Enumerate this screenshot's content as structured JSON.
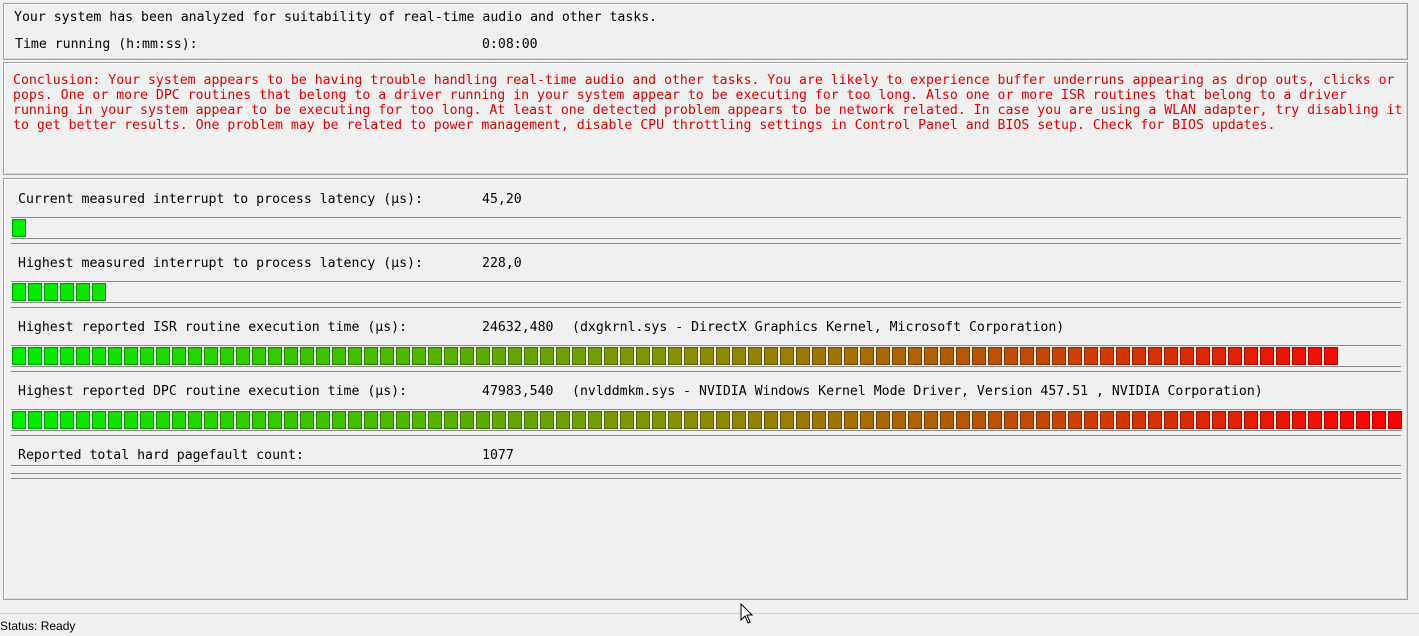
{
  "header": {
    "intro": "Your system has been analyzed for suitability of real-time audio and other tasks.",
    "time_label": "Time running (h:mm:ss):",
    "time_value": "0:08:00"
  },
  "conclusion": {
    "text": "Conclusion: Your system appears to be having trouble handling real-time audio and other tasks. You are likely to experience buffer underruns appearing as drop outs, clicks or pops. One or more DPC routines that belong to a driver running in your system appear to be executing for too long. Also one or more ISR routines that belong to a driver running in your system appear to be executing for too long. At least one detected problem appears to be network related. In case you are using a WLAN adapter, try disabling it to get better results. One problem may be related to power management, disable CPU throttling settings in Control Panel and BIOS setup. Check for BIOS updates.",
    "color": "#e00000"
  },
  "metrics": [
    {
      "label": "Current measured interrupt to process latency (µs):",
      "value": "45,20",
      "extra": "",
      "bar_fraction": 0.011
    },
    {
      "label": "Highest measured interrupt to process latency (µs):",
      "value": "228,0",
      "extra": "",
      "bar_fraction": 0.069
    },
    {
      "label": "Highest reported ISR routine execution time (µs):",
      "value": "24632,480",
      "extra": "(dxgkrnl.sys - DirectX Graphics Kernel, Microsoft Corporation)",
      "bar_fraction": 0.954
    },
    {
      "label": "Highest reported DPC routine execution time (µs):",
      "value": "47983,540",
      "extra": "(nvlddmkm.sys - NVIDIA Windows Kernel Mode Driver, Version 457.51 , NVIDIA Corporation)",
      "bar_fraction": 1.0
    },
    {
      "label": "Reported total hard pagefault count:",
      "value": "1077",
      "extra": "",
      "bar_fraction": 0
    }
  ],
  "bar_colors": {
    "start": "#00ee00",
    "end": "#ff0000"
  },
  "status": {
    "text": "Status: Ready"
  },
  "icons": {
    "cursor": "mouse-pointer-icon"
  }
}
